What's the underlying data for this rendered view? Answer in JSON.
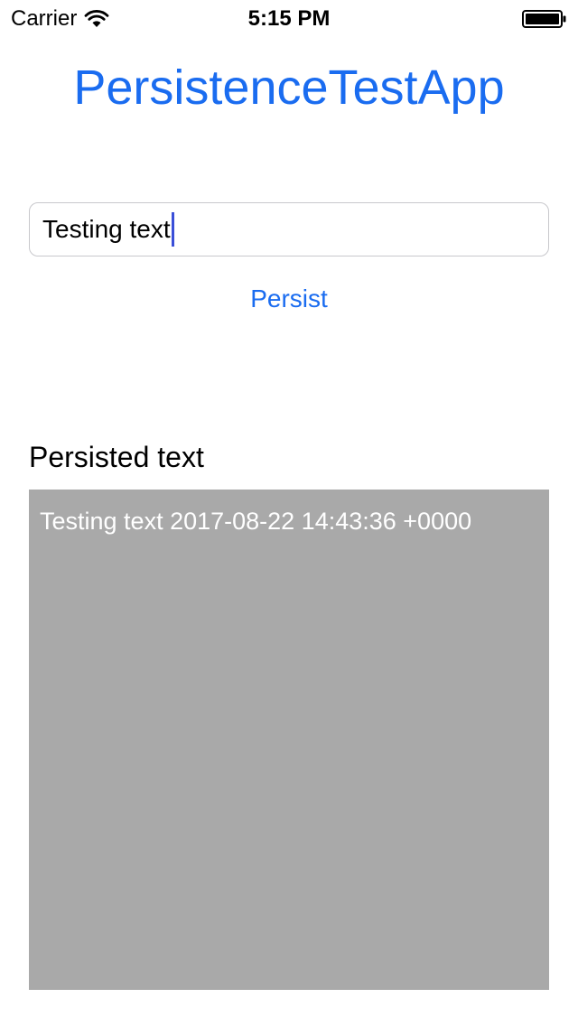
{
  "status_bar": {
    "carrier": "Carrier",
    "time": "5:15 PM",
    "wifi_icon": "wifi-icon",
    "battery_icon": "battery-icon"
  },
  "app": {
    "title": "PersistenceTestApp",
    "accent_color": "#1a6cf0"
  },
  "input": {
    "value": "Testing text"
  },
  "persist_button": {
    "label": "Persist"
  },
  "persisted_section": {
    "label": "Persisted text",
    "content": "Testing text 2017-08-22 14:43:36 +0000",
    "background_color": "#a9a9a9"
  }
}
